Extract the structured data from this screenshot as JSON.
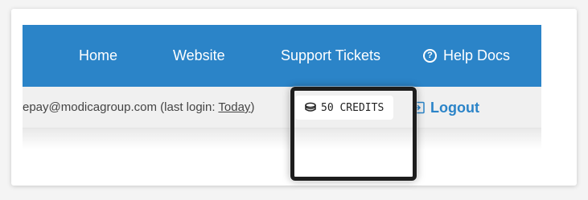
{
  "nav": {
    "items": [
      {
        "label": "Home"
      },
      {
        "label": "Website"
      },
      {
        "label": "Support Tickets"
      },
      {
        "label": "Help Docs",
        "icon": "help-circle-icon"
      }
    ],
    "background_color": "#2b84c8"
  },
  "account": {
    "email_prefix": "epay@modicagroup.com (last login: ",
    "last_login_link": "Today",
    "close_paren": ")",
    "credits_label": "50 CREDITS",
    "credits_icon": "coin-stack-icon",
    "logout_label": "Logout",
    "logout_icon": "logout-icon",
    "link_color": "#2b84c8"
  }
}
